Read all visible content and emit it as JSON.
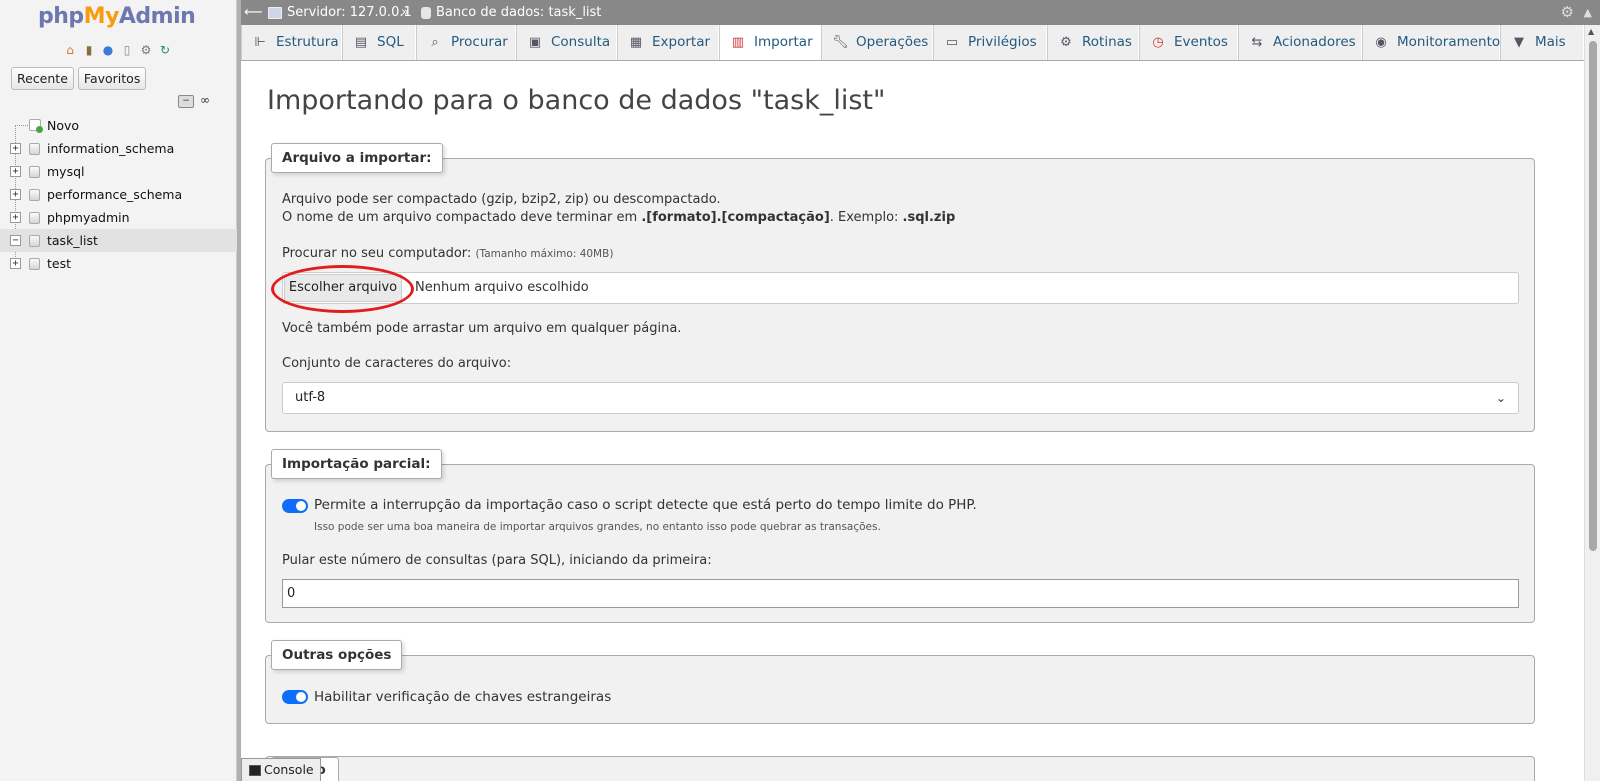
{
  "nav": {
    "logo_php": "php",
    "logo_my": "My",
    "logo_admin": "Admin",
    "icons": [
      "home-icon",
      "exit-icon",
      "help-icon",
      "docs-icon",
      "settings-icon",
      "reload-icon"
    ],
    "tabs": [
      "Recente",
      "Favoritos"
    ],
    "tree": [
      {
        "label": "Novo",
        "type": "new"
      },
      {
        "label": "information_schema",
        "type": "db"
      },
      {
        "label": "mysql",
        "type": "db"
      },
      {
        "label": "performance_schema",
        "type": "db"
      },
      {
        "label": "phpmyadmin",
        "type": "db"
      },
      {
        "label": "task_list",
        "type": "db",
        "active": true
      },
      {
        "label": "test",
        "type": "db"
      }
    ]
  },
  "topbar": {
    "server": "Servidor: 127.0.0.1",
    "separator": "»",
    "database": "Banco de dados: task_list"
  },
  "menu": {
    "tabs": [
      {
        "label": "Estrutura",
        "icon": "structure-icon"
      },
      {
        "label": "SQL",
        "icon": "sql-icon"
      },
      {
        "label": "Procurar",
        "icon": "search-icon"
      },
      {
        "label": "Consulta",
        "icon": "query-icon"
      },
      {
        "label": "Exportar",
        "icon": "export-icon"
      },
      {
        "label": "Importar",
        "icon": "import-icon",
        "active": true
      },
      {
        "label": "Operações",
        "icon": "wrench-icon"
      },
      {
        "label": "Privilégios",
        "icon": "privileges-icon"
      },
      {
        "label": "Rotinas",
        "icon": "routines-icon"
      },
      {
        "label": "Eventos",
        "icon": "clock-icon"
      },
      {
        "label": "Acionadores",
        "icon": "triggers-icon"
      },
      {
        "label": "Monitoramento",
        "icon": "eye-icon"
      },
      {
        "label": "Mais",
        "icon": "caret-down-icon"
      }
    ]
  },
  "page": {
    "title": "Importando para o banco de dados \"task_list\""
  },
  "file_section": {
    "legend": "Arquivo a importar:",
    "line1": "Arquivo pode ser compactado (gzip, bzip2, zip) ou descompactado.",
    "line2_prefix": "O nome de um arquivo compactado deve terminar em ",
    "line2_bold": ".[formato].[compactação]",
    "line2_mid": ". Exemplo: ",
    "line2_example": ".sql.zip",
    "browse_label": "Procurar no seu computador:",
    "max_size": "(Tamanho máximo: 40MB)",
    "choose_button": "Escolher arquivo",
    "no_file": "Nenhum arquivo escolhido",
    "drag_hint": "Você também pode arrastar um arquivo em qualquer página.",
    "charset_label": "Conjunto de caracteres do arquivo:",
    "charset_value": "utf-8"
  },
  "partial_section": {
    "legend": "Importação parcial:",
    "allow_interrupt": "Permite a interrupção da importação caso o script detecte que está perto do tempo limite do PHP.",
    "allow_interrupt_hint": "Isso pode ser uma boa maneira de importar arquivos grandes, no entanto isso pode quebrar as transações.",
    "skip_label": "Pular este número de consultas (para SQL), iniciando da primeira:",
    "skip_value": "0"
  },
  "other_section": {
    "legend": "Outras opções",
    "foreign_keys": "Habilitar verificação de chaves estrangeiras"
  },
  "next_legend_partial": "to",
  "console": {
    "label": "Console"
  },
  "colors": {
    "annotation": "#e01e1e",
    "toggle": "#0d6efd",
    "link": "#235a81"
  }
}
